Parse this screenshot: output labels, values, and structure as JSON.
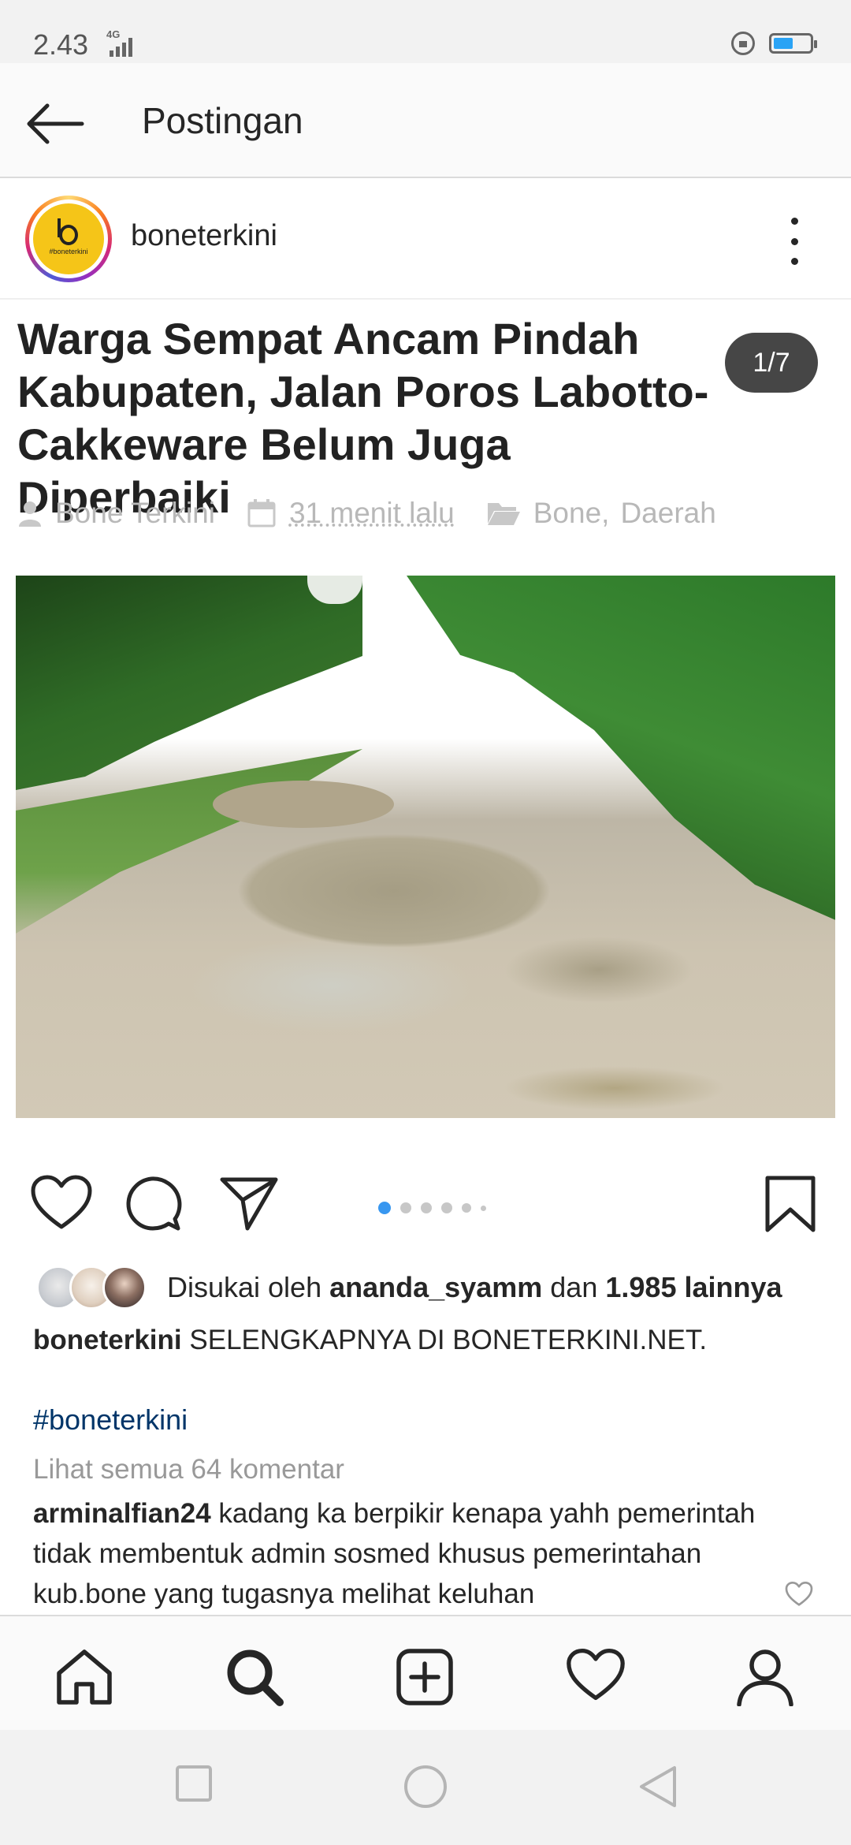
{
  "status_bar": {
    "time": "2.43",
    "network": "4G",
    "battery_level": 0.55,
    "icons": [
      "signal-icon",
      "lock-rotation-icon",
      "battery-icon"
    ]
  },
  "header": {
    "title": "Postingan",
    "back_icon": "arrow-left-icon"
  },
  "post": {
    "username": "boneterkini",
    "avatar_text": "#boneterkini",
    "more_icon": "more-vertical-icon",
    "article": {
      "title": "Warga Sempat Ancam Pindah Kabupaten, Jalan Poros Labotto-Cakkeware Belum Juga Diperbaiki",
      "author": "Bone Terkini",
      "time": "31 menit lalu",
      "category_1": "Bone,",
      "category_2": "Daerah"
    },
    "page_counter": "1/7",
    "carousel": {
      "current": 1,
      "dots_visible": 6
    },
    "likes": {
      "prefix": "Disukai oleh",
      "user": "ananda_syamm",
      "middle": "dan",
      "count": "1.985 lainnya"
    },
    "caption": {
      "user": "boneterkini",
      "text": "SELENGKAPNYA DI BONETERKINI.NET."
    },
    "hashtag": "#boneterkini",
    "view_comments": "Lihat semua 64 komentar",
    "comment": {
      "user": "arminalfian24",
      "text": "kadang ka berpikir kenapa yahh pemerintah tidak membentuk admin sosmed khusus pemerintahan kub.bone yang tugasnya melihat keluhan"
    }
  },
  "bottom_nav": [
    "home-icon",
    "search-icon",
    "add-post-icon",
    "activity-heart-icon",
    "profile-icon"
  ],
  "colors": {
    "accent_blue": "#3897f0",
    "hashtag": "#003569",
    "muted": "#999999"
  }
}
